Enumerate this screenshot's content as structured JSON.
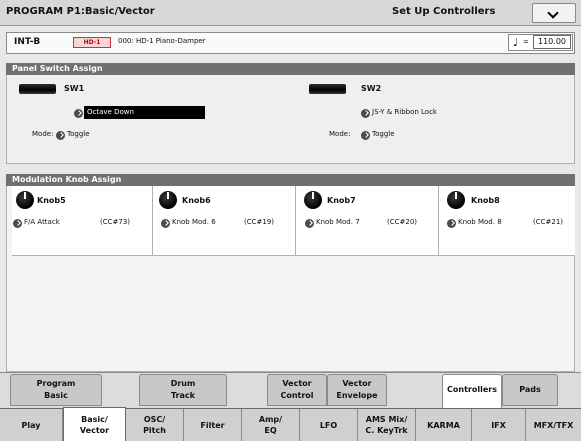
{
  "titlebar": {
    "title": "PROGRAM P1:Basic/Vector",
    "menu_label": "Set Up Controllers"
  },
  "program": {
    "bank": "INT-B",
    "badge": "HD-1",
    "name": "000: HD-1 Piano-Damper",
    "tempo_symbol": "♩",
    "tempo_eq": "=",
    "tempo": "110.00"
  },
  "panel_switch": {
    "header": "Panel Switch Assign",
    "sw1": {
      "label": "SW1",
      "value": "Octave Down",
      "mode_label": "Mode:",
      "mode": "Toggle"
    },
    "sw2": {
      "label": "SW2",
      "value": "JS-Y & Ribbon Lock",
      "mode_label": "Mode:",
      "mode": "Toggle"
    }
  },
  "mod_knob": {
    "header": "Modulation Knob Assign",
    "knobs": [
      {
        "name": "Knob5",
        "value": "F/A Attack",
        "cc": "(CC#73)"
      },
      {
        "name": "Knob6",
        "value": "Knob Mod. 6",
        "cc": "(CC#19)"
      },
      {
        "name": "Knob7",
        "value": "Knob Mod. 7",
        "cc": "(CC#20)"
      },
      {
        "name": "Knob8",
        "value": "Knob Mod. 8",
        "cc": "(CC#21)"
      }
    ]
  },
  "top_tabs": [
    {
      "line1": "Program",
      "line2": "Basic"
    },
    {
      "line1": "Drum",
      "line2": "Track"
    },
    {
      "line1": "Vector",
      "line2": "Control"
    },
    {
      "line1": "Vector",
      "line2": "Envelope"
    },
    {
      "line1": "Controllers",
      "line2": ""
    },
    {
      "line1": "Pads",
      "line2": ""
    }
  ],
  "bottom_tabs": [
    {
      "line1": "Play",
      "line2": ""
    },
    {
      "line1": "Basic/",
      "line2": "Vector"
    },
    {
      "line1": "OSC/",
      "line2": "Pitch"
    },
    {
      "line1": "Filter",
      "line2": ""
    },
    {
      "line1": "Amp/",
      "line2": "EQ"
    },
    {
      "line1": "LFO",
      "line2": ""
    },
    {
      "line1": "AMS Mix/",
      "line2": "C. KeyTrk"
    },
    {
      "line1": "KARMA",
      "line2": ""
    },
    {
      "line1": "IFX",
      "line2": ""
    },
    {
      "line1": "MFX/TFX",
      "line2": ""
    }
  ]
}
